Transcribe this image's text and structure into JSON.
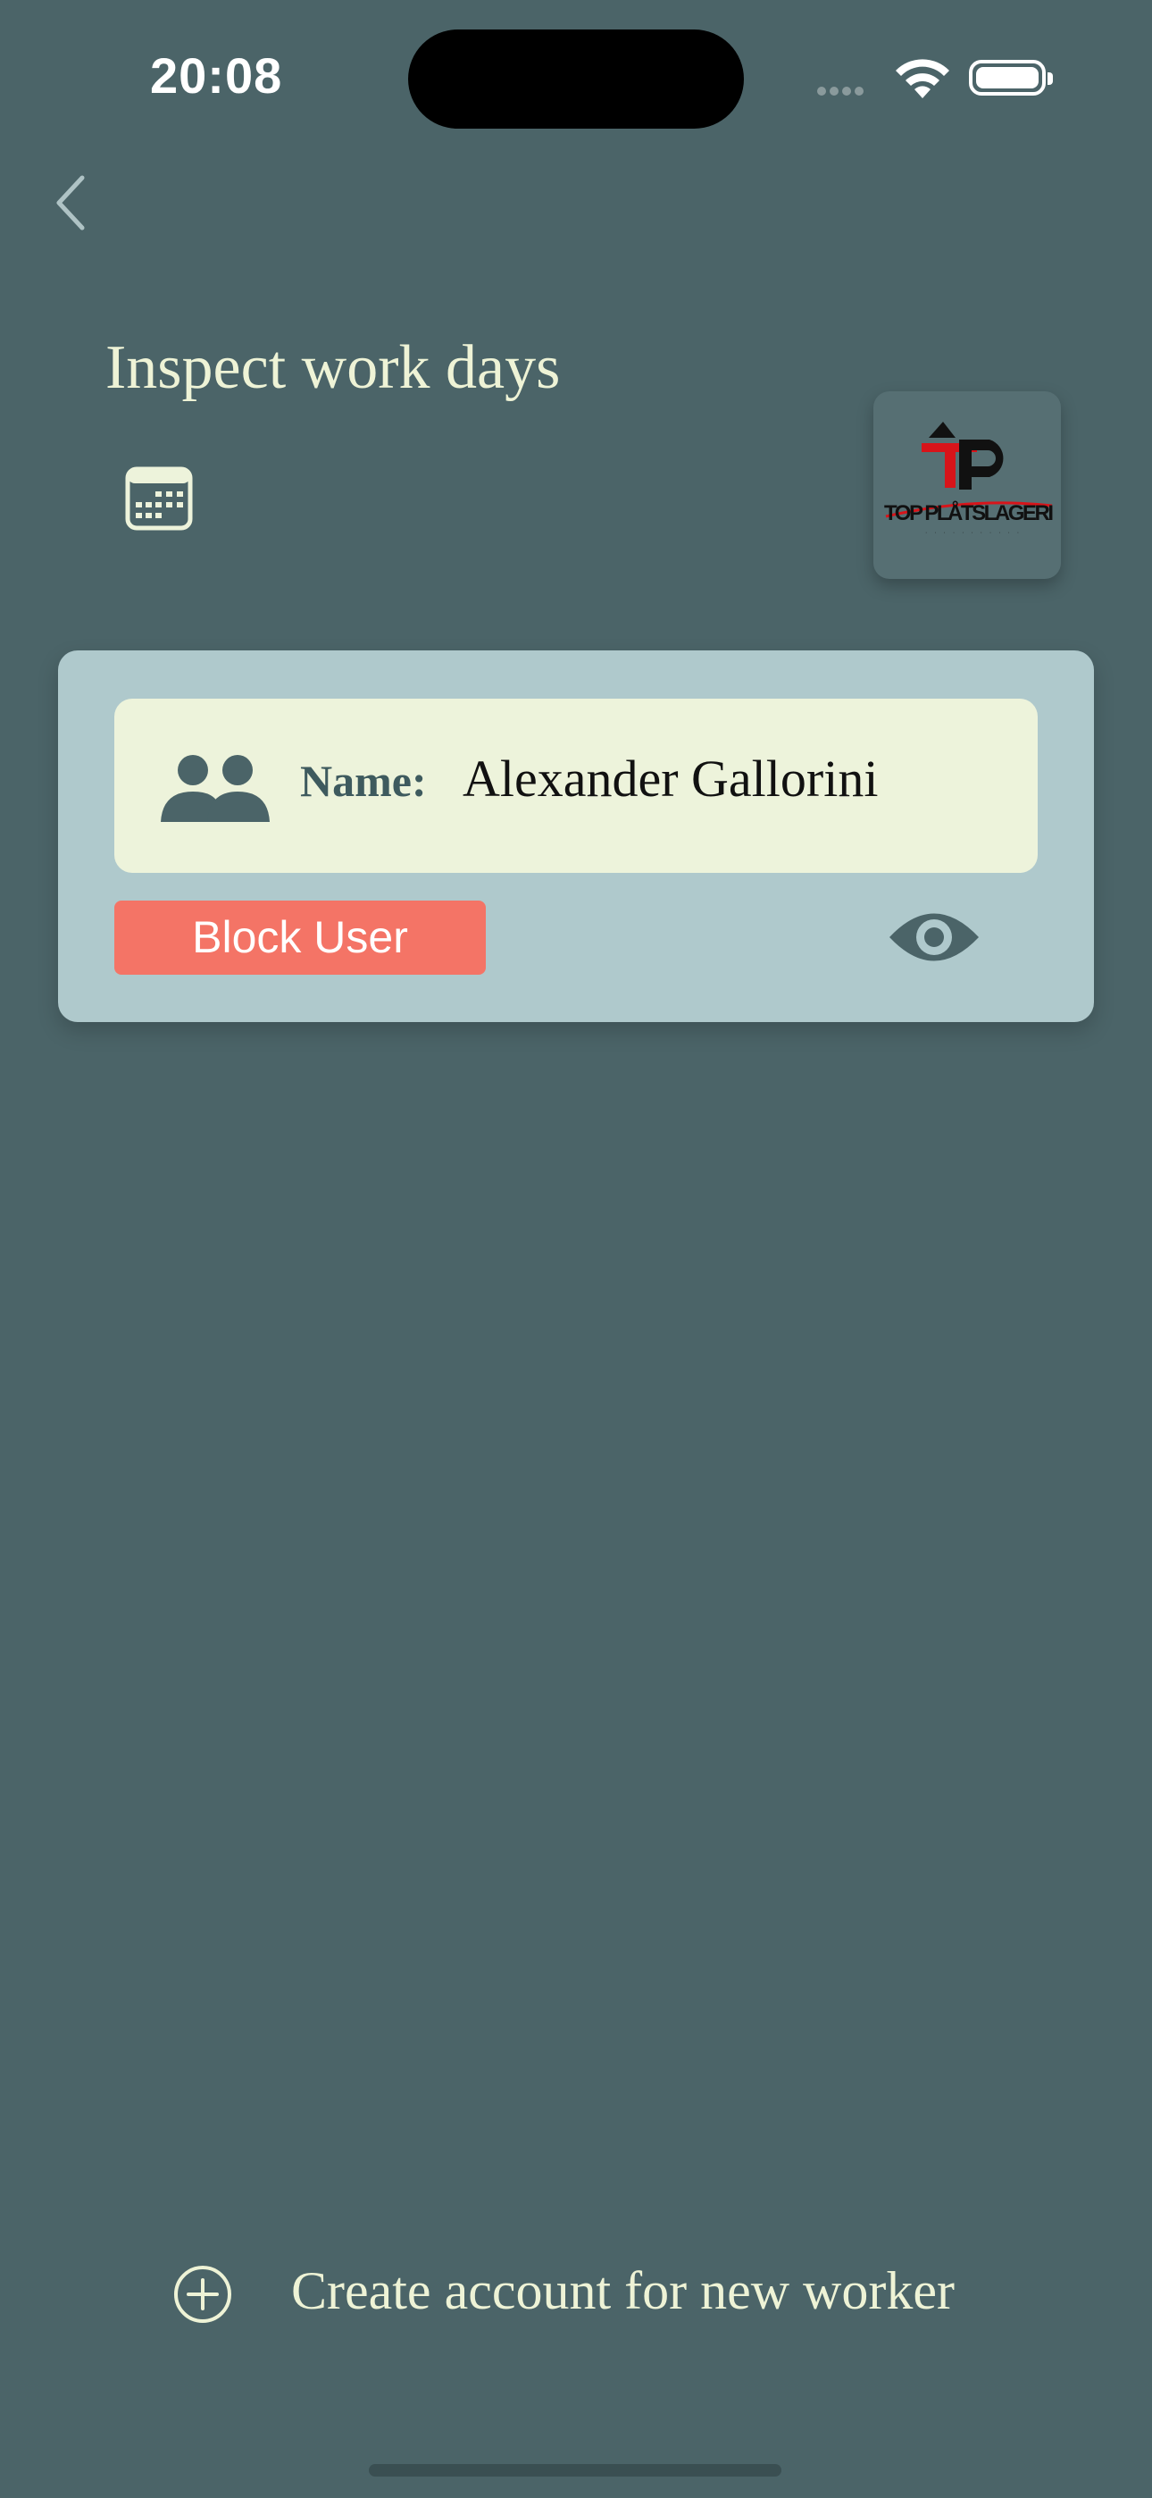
{
  "status_bar": {
    "time": "20:08"
  },
  "navigation": {
    "back_icon": "chevron-left-icon"
  },
  "header": {
    "title": "Inspect work days",
    "calendar_icon": "calendar-icon"
  },
  "logo": {
    "text": "TOP PLÅTSLAGERI"
  },
  "worker_card": {
    "name_label": "Name:",
    "name_value": "Alexander Gallorini",
    "block_button_label": "Block User",
    "people_icon": "people-icon",
    "view_icon": "eye-icon"
  },
  "footer": {
    "create_label": "Create account for new worker",
    "create_icon": "plus-circle-icon"
  },
  "colors": {
    "background": "#4B6468",
    "card": "#AFC9CC",
    "name_box": "#EDF3DB",
    "block_button": "#F47466",
    "title_text": "#EEF3D6"
  }
}
